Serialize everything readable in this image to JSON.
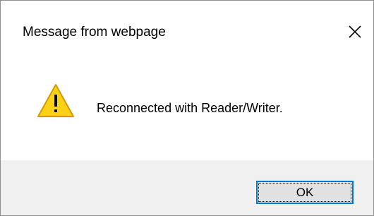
{
  "dialog": {
    "title": "Message from webpage",
    "message": "Reconnected with Reader/Writer.",
    "ok_label": "OK"
  },
  "icons": {
    "close": "close-icon",
    "warning": "warning-icon"
  },
  "colors": {
    "warning_fill": "#fcd116",
    "warning_stroke": "#d29a00",
    "button_focus_border": "#0078d7",
    "footer_bg": "#f0f0f0"
  }
}
